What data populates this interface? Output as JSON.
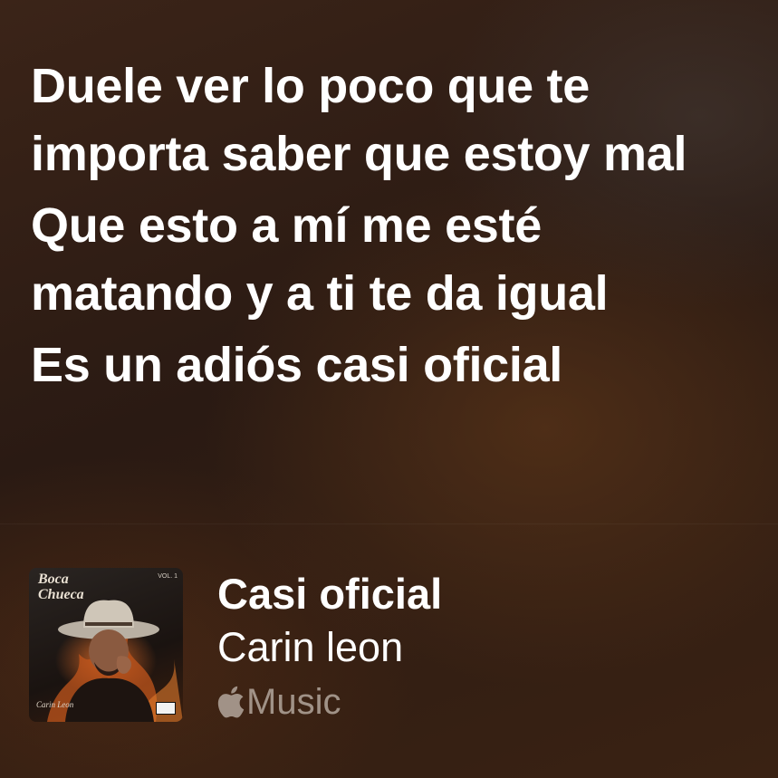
{
  "lyrics": {
    "lines": [
      "Duele ver lo poco que te importa saber que estoy mal",
      "Que esto a mí me esté matando y a ti te da igual",
      "Es un adiós casi oficial"
    ]
  },
  "now_playing": {
    "artwork": {
      "album_text": "Boca Chueca",
      "volume_text": "VOL. 1",
      "signature_text": "Carin Leon"
    },
    "title": "Casi oficial",
    "artist": "Carin leon",
    "service_icon": "apple-logo-icon",
    "service_label": "Music"
  }
}
